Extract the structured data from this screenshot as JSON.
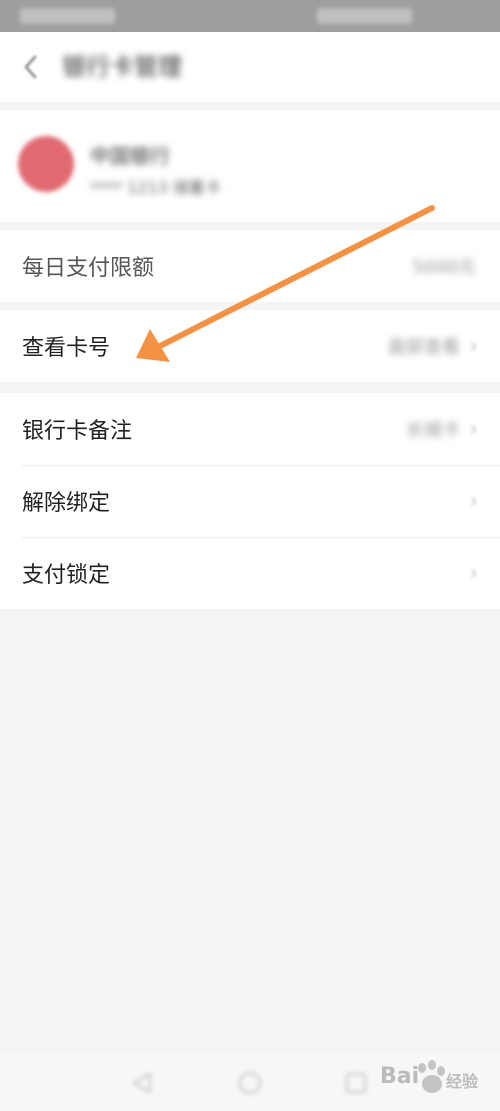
{
  "header": {
    "title": "银行卡管理",
    "back_icon": "chevron-left-icon"
  },
  "card": {
    "bank_name": "中国银行",
    "card_info": "**** 1213  储蓄卡"
  },
  "limit_row": {
    "label": "每日支付限额",
    "value": "5000元"
  },
  "card_number_row": {
    "label": "查看卡号",
    "value": "面部查看"
  },
  "other_rows": [
    {
      "label": "银行卡备注",
      "value": "长城卡"
    },
    {
      "label": "解除绑定",
      "value": ""
    },
    {
      "label": "支付锁定",
      "value": ""
    }
  ],
  "chevron": "›",
  "watermark": {
    "brand": "Bai",
    "suffix": "经验"
  },
  "colors": {
    "arrow": "#f49142",
    "bank_logo": "#e16a72",
    "background": "#f4f4f4"
  }
}
